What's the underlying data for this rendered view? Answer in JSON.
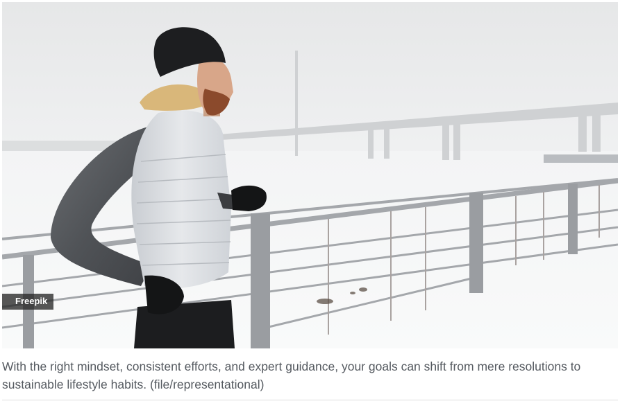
{
  "figure": {
    "image_alt": "Man jogging in winter along a snowy riverside railing",
    "credit": "Freepik",
    "caption": "With the right mindset, consistent efforts, and expert guidance, your goals can shift from mere resolutions to sustainable lifestyle habits. (file/representational)"
  }
}
